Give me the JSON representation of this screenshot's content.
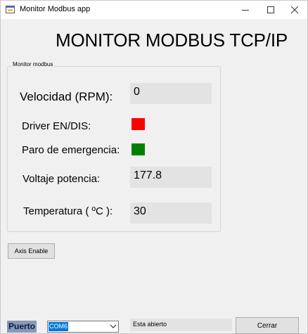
{
  "window": {
    "title": "Monitor Modbus app",
    "icon": "app-form-icon"
  },
  "header": {
    "title": "MONITOR MODBUS TCP/IP"
  },
  "group": {
    "legend": "Monitor modbus",
    "fields": {
      "velocidad": {
        "label": "Velocidad (RPM):",
        "value": "0"
      },
      "driver": {
        "label": "Driver EN/DIS:",
        "status_color": "#ff0000"
      },
      "paro": {
        "label": "Paro de emergencia:",
        "status_color": "#008000"
      },
      "voltaje": {
        "label": "Voltaje potencia:",
        "value": "177.8"
      },
      "temperatura": {
        "label": "Temperatura ( ºC ):",
        "value": "30"
      }
    }
  },
  "controls": {
    "axis_enable_label": "Axis Enable",
    "puerto_label": "Puerto",
    "port_selected": "COM6",
    "status_text": "Esta abierto",
    "cerrar_label": "Cerrar"
  },
  "colors": {
    "accent": "#0078d7",
    "driver_indicator": "#ff0000",
    "emergency_indicator": "#008000"
  }
}
